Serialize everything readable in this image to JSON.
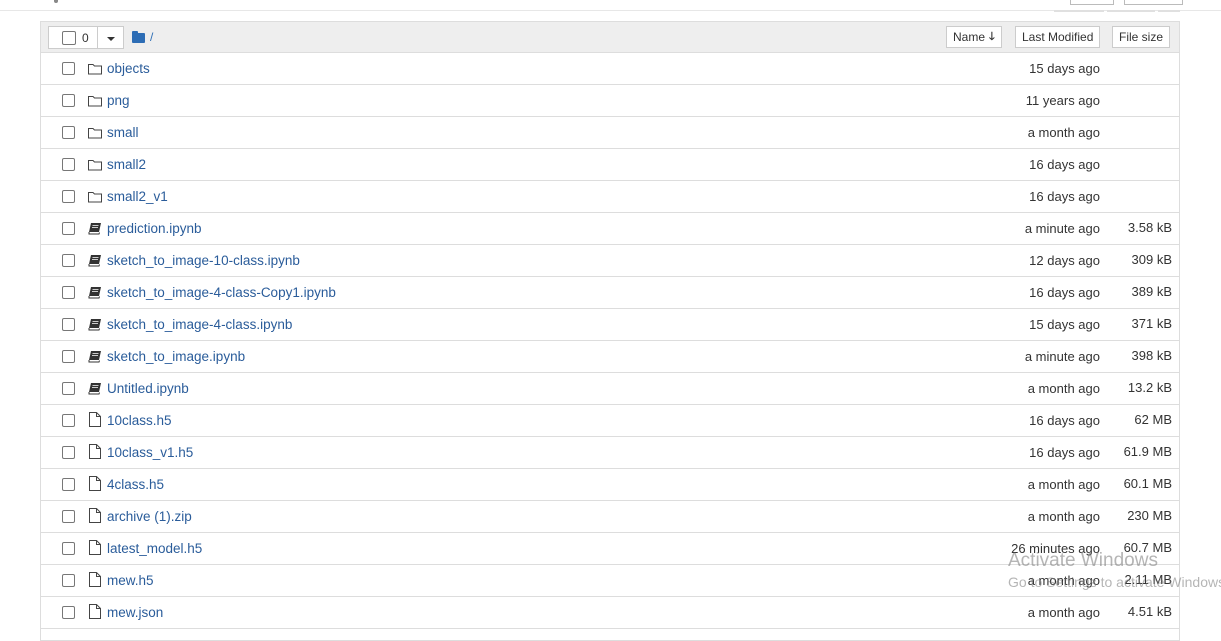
{
  "toolbar": {
    "selected_count": "0",
    "breadcrumb_path": "/",
    "sort_buttons": {
      "name": "Name",
      "name_sort_icon": "arrow-down-icon",
      "last_modified": "Last Modified",
      "file_size": "File size"
    }
  },
  "files": [
    {
      "type": "folder",
      "icon": "folder-icon",
      "name": "objects",
      "modified": "15 days ago",
      "size": ""
    },
    {
      "type": "folder",
      "icon": "folder-icon",
      "name": "png",
      "modified": "11 years ago",
      "size": ""
    },
    {
      "type": "folder",
      "icon": "folder-icon",
      "name": "small",
      "modified": "a month ago",
      "size": ""
    },
    {
      "type": "folder",
      "icon": "folder-icon",
      "name": "small2",
      "modified": "16 days ago",
      "size": ""
    },
    {
      "type": "folder",
      "icon": "folder-icon",
      "name": "small2_v1",
      "modified": "16 days ago",
      "size": ""
    },
    {
      "type": "notebook",
      "icon": "notebook-icon",
      "name": "prediction.ipynb",
      "modified": "a minute ago",
      "size": "3.58 kB"
    },
    {
      "type": "notebook",
      "icon": "notebook-icon",
      "name": "sketch_to_image-10-class.ipynb",
      "modified": "12 days ago",
      "size": "309 kB"
    },
    {
      "type": "notebook",
      "icon": "notebook-icon",
      "name": "sketch_to_image-4-class-Copy1.ipynb",
      "modified": "16 days ago",
      "size": "389 kB"
    },
    {
      "type": "notebook",
      "icon": "notebook-icon",
      "name": "sketch_to_image-4-class.ipynb",
      "modified": "15 days ago",
      "size": "371 kB"
    },
    {
      "type": "notebook",
      "icon": "notebook-icon",
      "name": "sketch_to_image.ipynb",
      "modified": "a minute ago",
      "size": "398 kB"
    },
    {
      "type": "notebook",
      "icon": "notebook-icon",
      "name": "Untitled.ipynb",
      "modified": "a month ago",
      "size": "13.2 kB"
    },
    {
      "type": "file",
      "icon": "file-icon",
      "name": "10class.h5",
      "modified": "16 days ago",
      "size": "62 MB"
    },
    {
      "type": "file",
      "icon": "file-icon",
      "name": "10class_v1.h5",
      "modified": "16 days ago",
      "size": "61.9 MB"
    },
    {
      "type": "file",
      "icon": "file-icon",
      "name": "4class.h5",
      "modified": "a month ago",
      "size": "60.1 MB"
    },
    {
      "type": "file",
      "icon": "file-icon",
      "name": "archive (1).zip",
      "modified": "a month ago",
      "size": "230 MB"
    },
    {
      "type": "file",
      "icon": "file-icon",
      "name": "latest_model.h5",
      "modified": "26 minutes ago",
      "size": "60.7 MB"
    },
    {
      "type": "file",
      "icon": "file-icon",
      "name": "mew.h5",
      "modified": "a month ago",
      "size": "2.11 MB"
    },
    {
      "type": "file",
      "icon": "file-icon",
      "name": "mew.json",
      "modified": "a month ago",
      "size": "4.51 kB"
    }
  ],
  "watermark": {
    "line1": "Activate Windows",
    "line2": "Go to Settings to activate Windows."
  },
  "colors": {
    "link": "#2a5c9a",
    "folder_accent": "#2d6db5",
    "header_bg": "#eeeeee",
    "border": "#dddddd"
  }
}
